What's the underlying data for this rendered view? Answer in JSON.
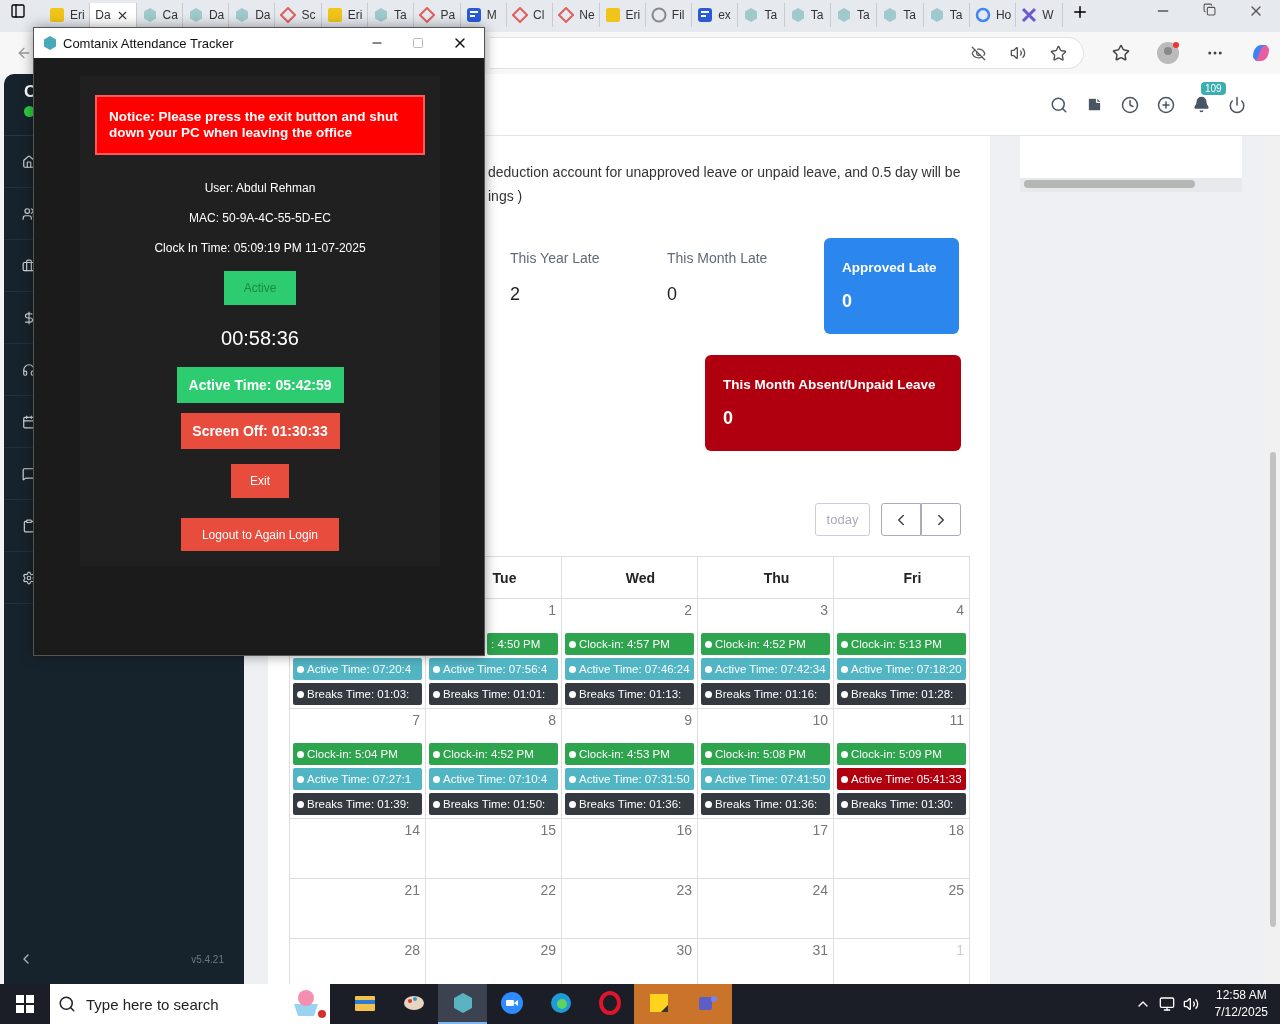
{
  "browser": {
    "tabs": [
      {
        "label": "Eri",
        "selected": false
      },
      {
        "label": "Da",
        "selected": true
      },
      {
        "label": "Ca",
        "selected": false
      },
      {
        "label": "Da",
        "selected": false
      },
      {
        "label": "Da",
        "selected": false
      },
      {
        "label": "Sc",
        "selected": false
      },
      {
        "label": "Eri",
        "selected": false
      },
      {
        "label": "Ta",
        "selected": false
      },
      {
        "label": "Pa",
        "selected": false
      },
      {
        "label": "M",
        "selected": false
      },
      {
        "label": "Cl",
        "selected": false
      },
      {
        "label": "Ne",
        "selected": false
      },
      {
        "label": "Eri",
        "selected": false
      },
      {
        "label": "Fil",
        "selected": false
      },
      {
        "label": "ex",
        "selected": false
      },
      {
        "label": "Ta",
        "selected": false
      },
      {
        "label": "Ta",
        "selected": false
      },
      {
        "label": "Ta",
        "selected": false
      },
      {
        "label": "Ta",
        "selected": false
      },
      {
        "label": "Ta",
        "selected": false
      },
      {
        "label": "Ho",
        "selected": false
      },
      {
        "label": "W",
        "selected": false
      }
    ]
  },
  "sidebar": {
    "brand": "C",
    "version": "v5.4.21"
  },
  "header": {
    "notification_count": "109"
  },
  "policy_text": [
    "deduction account for unapproved leave or unpaid leave, and 0.5 day will be",
    "ings )"
  ],
  "stats": [
    {
      "label": "This Year Late",
      "value": "2"
    },
    {
      "label": "This Month Late",
      "value": "0"
    }
  ],
  "cards": [
    {
      "label": "Approved Late",
      "value": "0",
      "color": "#2b86ee"
    },
    {
      "label": "This Month Absent/Unpaid Leave",
      "value": "0",
      "color": "#b0000f"
    }
  ],
  "calendar": {
    "today_button": "today",
    "today_disabled": true,
    "day_headers": [
      "Tue",
      "Wed",
      "Thu",
      "Fri"
    ],
    "weeks": [
      {
        "days": [
          {
            "events": [
              {
                "text": "Active Time: 07:20:4",
                "color": "#52b5c4",
                "partial": false
              },
              {
                "text": "Breaks Time: 01:03:",
                "color": "#343a40",
                "partial": false
              }
            ]
          },
          {
            "number": "1",
            "other_month": false,
            "events": [
              {
                "text": ": 4:50 PM",
                "color": "#2ea44f",
                "partial": true
              },
              {
                "text": "Active Time: 07:56:4",
                "color": "#52b5c4",
                "partial": false
              },
              {
                "text": "Breaks Time: 01:01:",
                "color": "#343a40",
                "partial": false
              }
            ]
          },
          {
            "number": "2",
            "other_month": false,
            "events": [
              {
                "text": "Clock-in: 4:57 PM",
                "color": "#2ea44f",
                "partial": false
              },
              {
                "text": "Active Time: 07:46:24",
                "color": "#52b5c4",
                "partial": false
              },
              {
                "text": "Breaks Time: 01:13:",
                "color": "#343a40",
                "partial": false
              }
            ]
          },
          {
            "number": "3",
            "other_month": false,
            "events": [
              {
                "text": "Clock-in: 4:52 PM",
                "color": "#2ea44f",
                "partial": false
              },
              {
                "text": "Active Time: 07:42:34",
                "color": "#52b5c4",
                "partial": false
              },
              {
                "text": "Breaks Time: 01:16:",
                "color": "#343a40",
                "partial": false
              }
            ]
          },
          {
            "number": "4",
            "other_month": false,
            "events": [
              {
                "text": "Clock-in: 5:13 PM",
                "color": "#2ea44f",
                "partial": false
              },
              {
                "text": "Active Time: 07:18:20",
                "color": "#52b5c4",
                "partial": false
              },
              {
                "text": "Breaks Time: 01:28:",
                "color": "#343a40",
                "partial": false
              }
            ]
          }
        ]
      },
      {
        "days": [
          {
            "number": "7",
            "other_month": false,
            "events": [
              {
                "text": "Clock-in: 5:04 PM",
                "color": "#2ea44f",
                "partial": false
              },
              {
                "text": "Active Time: 07:27:1",
                "color": "#52b5c4",
                "partial": false
              },
              {
                "text": "Breaks Time: 01:39:",
                "color": "#343a40",
                "partial": false
              }
            ]
          },
          {
            "number": "8",
            "other_month": false,
            "events": [
              {
                "text": "Clock-in: 4:52 PM",
                "color": "#2ea44f",
                "partial": false
              },
              {
                "text": "Active Time: 07:10:4",
                "color": "#52b5c4",
                "partial": false
              },
              {
                "text": "Breaks Time: 01:50:",
                "color": "#343a40",
                "partial": false
              }
            ]
          },
          {
            "number": "9",
            "other_month": false,
            "events": [
              {
                "text": "Clock-in: 4:53 PM",
                "color": "#2ea44f",
                "partial": false
              },
              {
                "text": "Active Time: 07:31:50",
                "color": "#52b5c4",
                "partial": false
              },
              {
                "text": "Breaks Time: 01:36:",
                "color": "#343a40",
                "partial": false
              }
            ]
          },
          {
            "number": "10",
            "other_month": false,
            "events": [
              {
                "text": "Clock-in: 5:08 PM",
                "color": "#2ea44f",
                "partial": false
              },
              {
                "text": "Active Time: 07:41:50",
                "color": "#52b5c4",
                "partial": false
              },
              {
                "text": "Breaks Time: 01:36:",
                "color": "#343a40",
                "partial": false
              }
            ]
          },
          {
            "number": "11",
            "other_month": false,
            "events": [
              {
                "text": "Clock-in: 5:09 PM",
                "color": "#2ea44f",
                "partial": false
              },
              {
                "text": "Active Time: 05:41:33",
                "color": "#b0000f",
                "partial": false
              },
              {
                "text": "Breaks Time: 01:30:",
                "color": "#343a40",
                "partial": false
              }
            ]
          }
        ]
      },
      {
        "days": [
          {
            "number": "14",
            "other_month": false
          },
          {
            "number": "15",
            "other_month": false
          },
          {
            "number": "16",
            "other_month": false
          },
          {
            "number": "17",
            "other_month": false
          },
          {
            "number": "18",
            "other_month": false
          }
        ]
      },
      {
        "days": [
          {
            "number": "21",
            "other_month": false
          },
          {
            "number": "22",
            "other_month": false
          },
          {
            "number": "23",
            "other_month": false
          },
          {
            "number": "24",
            "other_month": false
          },
          {
            "number": "25",
            "other_month": false
          }
        ]
      },
      {
        "days": [
          {
            "number": "28",
            "other_month": false
          },
          {
            "number": "29",
            "other_month": false
          },
          {
            "number": "30",
            "other_month": false
          },
          {
            "number": "31",
            "other_month": false
          },
          {
            "number": "1",
            "other_month": true
          }
        ]
      }
    ]
  },
  "tracker": {
    "title": "Comtanix Attendance Tracker",
    "notice": "Notice: Please press the exit button and shut down your PC when leaving the office",
    "user": "User: Abdul Rehman",
    "mac": "MAC: 50-9A-4C-55-5D-EC",
    "clock_in": "Clock In Time: 05:09:19 PM 11-07-2025",
    "status": "Active",
    "timer": "00:58:36",
    "buttons": [
      {
        "label": "Active Time: 05:42:59",
        "kind": "active"
      },
      {
        "label": "Screen Off: 01:30:33",
        "kind": "screen_off"
      },
      {
        "label": "Exit",
        "kind": "exit"
      },
      {
        "label": "Logout to Again Login",
        "kind": "logout"
      }
    ]
  },
  "taskbar": {
    "search_placeholder": "Type here to search",
    "time": "12:58 AM",
    "date": "7/12/2025",
    "apps": [
      {
        "kind": "folder",
        "selected": false,
        "attention": false
      },
      {
        "kind": "paint",
        "selected": false,
        "attention": false
      },
      {
        "kind": "tracker",
        "selected": true,
        "attention": false
      },
      {
        "kind": "zoom",
        "selected": false,
        "attention": false
      },
      {
        "kind": "edge",
        "selected": false,
        "attention": false
      },
      {
        "kind": "opera",
        "selected": false,
        "attention": false
      },
      {
        "kind": "notes",
        "selected": false,
        "attention": true
      },
      {
        "kind": "teams",
        "selected": false,
        "attention": true
      }
    ]
  }
}
